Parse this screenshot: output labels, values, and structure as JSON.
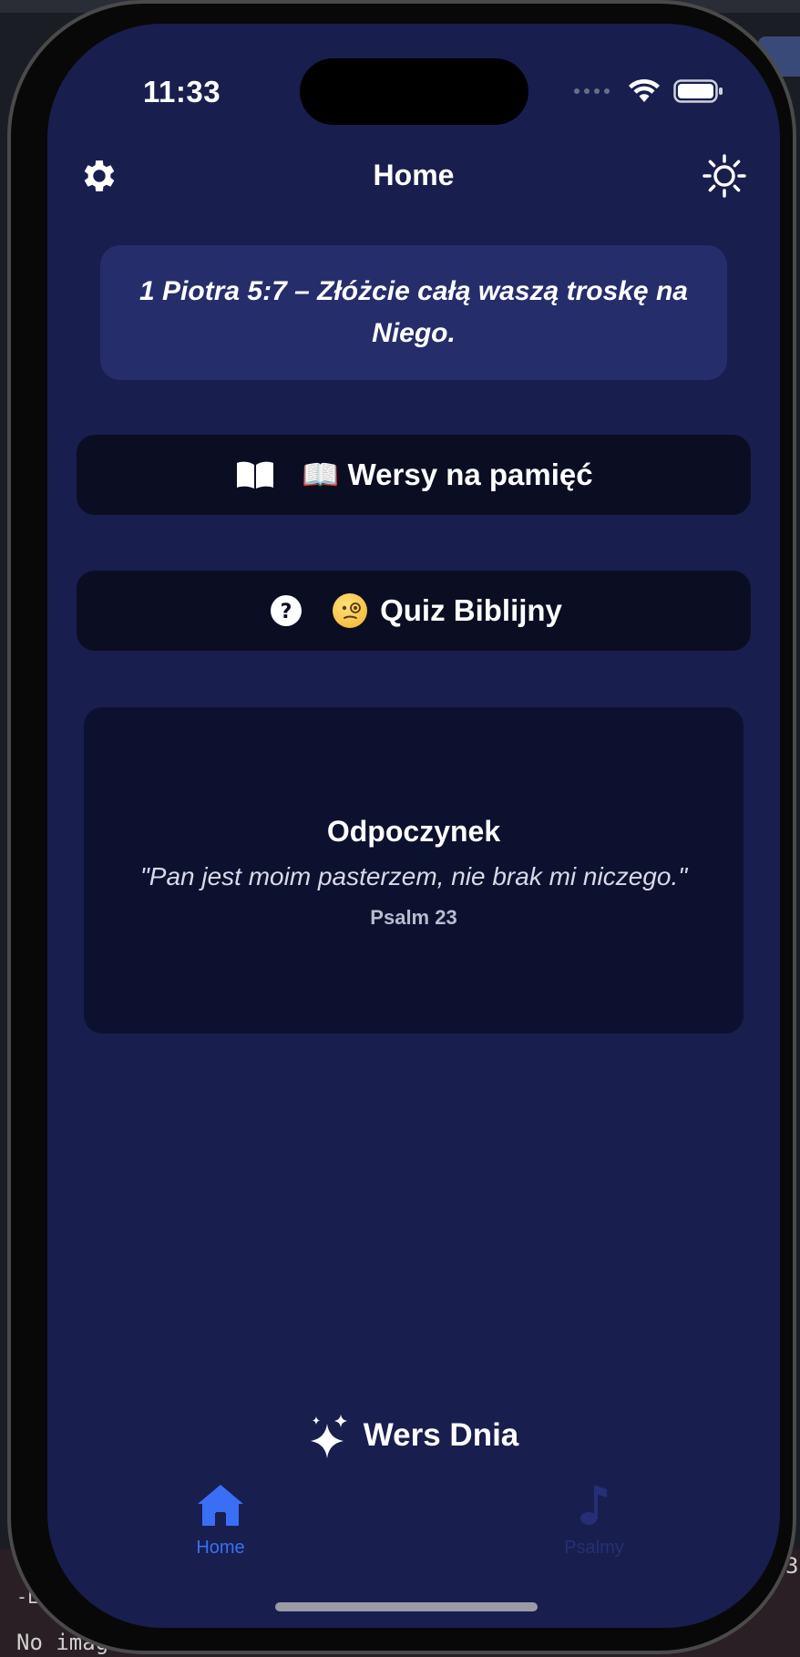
{
  "status_bar": {
    "time": "11:33"
  },
  "nav": {
    "title": "Home",
    "settings_icon": "gear-icon",
    "theme_icon": "sun-icon"
  },
  "verse_of_day_card": {
    "text": "1 Piotra 5:7 – Złóżcie całą waszą troskę na Niego."
  },
  "menu": {
    "memory": {
      "label": "📖 Wersy na pamięć",
      "icon": "open-book-icon"
    },
    "quiz": {
      "label": "Quiz Biblijny",
      "icon": "question-circle-icon"
    }
  },
  "mood_card": {
    "title": "Odpoczynek",
    "quote": "\"Pan jest moim pasterzem, nie brak mi niczego.\"",
    "reference": "Psalm 23"
  },
  "daily_button": {
    "label": "Wers Dnia",
    "icon": "sparkles-icon"
  },
  "tab_bar": {
    "tabs": [
      {
        "label": "Home",
        "icon": "house-icon",
        "active": true
      },
      {
        "label": "Psalmy",
        "icon": "music-note-icon",
        "active": false
      }
    ]
  },
  "background": {
    "console_text": "No image",
    "dash_text": "-L",
    "right_digit": "3"
  },
  "colors": {
    "screen_bg": "#181f4e",
    "card_bg": "#252d6b",
    "button_bg": "#0b0e22",
    "accent": "#3a6ff5"
  }
}
